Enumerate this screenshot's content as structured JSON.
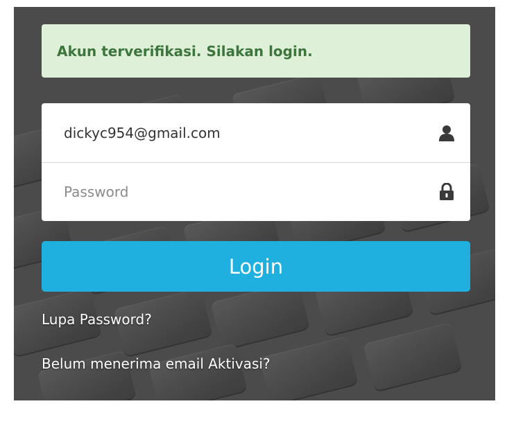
{
  "alert": {
    "message": "Akun terverifikasi. Silakan login.",
    "background": "#dff0d8",
    "text_color": "#3c763d"
  },
  "form": {
    "email": {
      "value": "dickyc954@gmail.com",
      "icon": "user-icon"
    },
    "password": {
      "value": "",
      "placeholder": "Password",
      "icon": "lock-icon"
    },
    "login_label": "Login",
    "login_color": "#1fb0e0"
  },
  "links": {
    "forgot_password": "Lupa Password?",
    "resend_activation": "Belum menerima email Aktivasi?"
  }
}
